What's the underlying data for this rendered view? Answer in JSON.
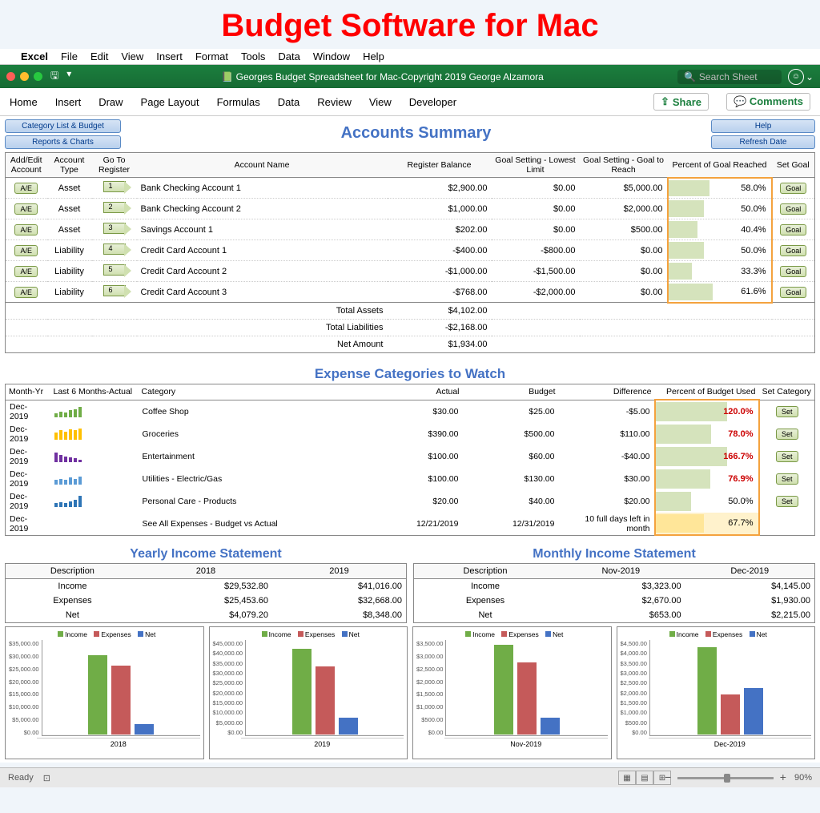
{
  "page_heading": "Budget Software for Mac",
  "menubar": [
    "Excel",
    "File",
    "Edit",
    "View",
    "Insert",
    "Format",
    "Tools",
    "Data",
    "Window",
    "Help"
  ],
  "doc_title": "Georges Budget Spreadsheet for Mac-Copyright 2019 George Alzamora",
  "search_placeholder": "Search Sheet",
  "ribbon": [
    "Home",
    "Insert",
    "Draw",
    "Page Layout",
    "Formulas",
    "Data",
    "Review",
    "View",
    "Developer"
  ],
  "share_label": "Share",
  "comments_label": "Comments",
  "buttons": {
    "cat_list": "Category List & Budget",
    "reports": "Reports & Charts",
    "help": "Help",
    "refresh": "Refresh Date"
  },
  "accounts_summary": {
    "title": "Accounts Summary",
    "headers": {
      "ae": "Add/Edit Account",
      "type": "Account Type",
      "goto": "Go To Register",
      "name": "Account Name",
      "balance": "Register Balance",
      "lowest": "Goal Setting - Lowest Limit",
      "goal": "Goal Setting - Goal to Reach",
      "percent": "Percent of Goal Reached",
      "set": "Set Goal"
    },
    "ae_label": "A/E",
    "goal_label": "Goal",
    "rows": [
      {
        "n": "1",
        "type": "Asset",
        "name": "Bank Checking Account 1",
        "balance": "$2,900.00",
        "lowest": "$0.00",
        "goal": "$5,000.00",
        "pct": 58.0,
        "pct_txt": "58.0%"
      },
      {
        "n": "2",
        "type": "Asset",
        "name": "Bank Checking Account 2",
        "balance": "$1,000.00",
        "lowest": "$0.00",
        "goal": "$2,000.00",
        "pct": 50.0,
        "pct_txt": "50.0%"
      },
      {
        "n": "3",
        "type": "Asset",
        "name": "Savings Account 1",
        "balance": "$202.00",
        "lowest": "$0.00",
        "goal": "$500.00",
        "pct": 40.4,
        "pct_txt": "40.4%"
      },
      {
        "n": "4",
        "type": "Liability",
        "name": "Credit Card Account 1",
        "balance": "-$400.00",
        "lowest": "-$800.00",
        "goal": "$0.00",
        "pct": 50.0,
        "pct_txt": "50.0%"
      },
      {
        "n": "5",
        "type": "Liability",
        "name": "Credit Card Account 2",
        "balance": "-$1,000.00",
        "lowest": "-$1,500.00",
        "goal": "$0.00",
        "pct": 33.3,
        "pct_txt": "33.3%"
      },
      {
        "n": "6",
        "type": "Liability",
        "name": "Credit Card Account 3",
        "balance": "-$768.00",
        "lowest": "-$2,000.00",
        "goal": "$0.00",
        "pct": 61.6,
        "pct_txt": "61.6%"
      }
    ],
    "totals": {
      "assets_l": "Total Assets",
      "assets_v": "$4,102.00",
      "liab_l": "Total Liabilities",
      "liab_v": "-$2,168.00",
      "net_l": "Net Amount",
      "net_v": "$1,934.00"
    }
  },
  "expense_watch": {
    "title": "Expense Categories to Watch",
    "headers": {
      "month": "Month-Yr",
      "last6": "Last 6 Months-Actual",
      "cat": "Category",
      "actual": "Actual",
      "budget": "Budget",
      "diff": "Difference",
      "pct": "Percent of Budget Used",
      "set": "Set Category"
    },
    "set_label": "Set",
    "rows": [
      {
        "month": "Dec-2019",
        "spark": [
          3,
          5,
          4,
          6,
          7,
          9
        ],
        "color": "#70ad47",
        "cat": "Coffee Shop",
        "actual": "$30.00",
        "budget": "$25.00",
        "diff": "-$5.00",
        "pct": 120.0,
        "pct_txt": "120.0%",
        "over": true
      },
      {
        "month": "Dec-2019",
        "spark": [
          6,
          8,
          7,
          9,
          8,
          10
        ],
        "color": "#ffc000",
        "cat": "Groceries",
        "actual": "$390.00",
        "budget": "$500.00",
        "diff": "$110.00",
        "pct": 78.0,
        "pct_txt": "78.0%",
        "over": true
      },
      {
        "month": "Dec-2019",
        "spark": [
          8,
          6,
          5,
          4,
          3,
          2
        ],
        "color": "#7030a0",
        "cat": "Entertainment",
        "actual": "$100.00",
        "budget": "$60.00",
        "diff": "-$40.00",
        "pct": 166.7,
        "pct_txt": "166.7%",
        "over": true
      },
      {
        "month": "Dec-2019",
        "spark": [
          4,
          5,
          4,
          6,
          5,
          7
        ],
        "color": "#5b9bd5",
        "cat": "Utilities - Electric/Gas",
        "actual": "$100.00",
        "budget": "$130.00",
        "diff": "$30.00",
        "pct": 76.9,
        "pct_txt": "76.9%",
        "over": true
      },
      {
        "month": "Dec-2019",
        "spark": [
          3,
          4,
          3,
          5,
          6,
          10
        ],
        "color": "#2e75b6",
        "cat": "Personal Care - Products",
        "actual": "$20.00",
        "budget": "$40.00",
        "diff": "$20.00",
        "pct": 50.0,
        "pct_txt": "50.0%",
        "over": false
      }
    ],
    "summary": {
      "month": "Dec-2019",
      "cat": "See All Expenses - Budget vs Actual",
      "actual": "12/21/2019",
      "budget": "12/31/2019",
      "diff": "10 full days left in month",
      "pct": 67.7,
      "pct_txt": "67.7%"
    }
  },
  "yearly": {
    "title": "Yearly Income Statement",
    "headers": {
      "desc": "Description",
      "c1": "2018",
      "c2": "2019"
    },
    "rows": [
      {
        "desc": "Income",
        "c1": "$29,532.80",
        "c2": "$41,016.00"
      },
      {
        "desc": "Expenses",
        "c1": "$25,453.60",
        "c2": "$32,668.00"
      },
      {
        "desc": "Net",
        "c1": "$4,079.20",
        "c2": "$8,348.00"
      }
    ]
  },
  "monthly": {
    "title": "Monthly Income Statement",
    "headers": {
      "desc": "Description",
      "c1": "Nov-2019",
      "c2": "Dec-2019"
    },
    "rows": [
      {
        "desc": "Income",
        "c1": "$3,323.00",
        "c2": "$4,145.00"
      },
      {
        "desc": "Expenses",
        "c1": "$2,670.00",
        "c2": "$1,930.00"
      },
      {
        "desc": "Net",
        "c1": "$653.00",
        "c2": "$2,215.00"
      }
    ]
  },
  "chart_legend": {
    "income": "Income",
    "expenses": "Expenses",
    "net": "Net"
  },
  "chart_data": [
    {
      "type": "bar",
      "title": "2018",
      "categories": [
        "Income",
        "Expenses",
        "Net"
      ],
      "values": [
        29532.8,
        25453.6,
        4079.2
      ],
      "ylim": [
        0,
        35000
      ],
      "yticks": [
        "$35,000.00",
        "$30,000.00",
        "$25,000.00",
        "$20,000.00",
        "$15,000.00",
        "$10,000.00",
        "$5,000.00",
        "$0.00"
      ]
    },
    {
      "type": "bar",
      "title": "2019",
      "categories": [
        "Income",
        "Expenses",
        "Net"
      ],
      "values": [
        41016.0,
        32668.0,
        8348.0
      ],
      "ylim": [
        0,
        45000
      ],
      "yticks": [
        "$45,000.00",
        "$40,000.00",
        "$35,000.00",
        "$30,000.00",
        "$25,000.00",
        "$20,000.00",
        "$15,000.00",
        "$10,000.00",
        "$5,000.00",
        "$0.00"
      ]
    },
    {
      "type": "bar",
      "title": "Nov-2019",
      "categories": [
        "Income",
        "Expenses",
        "Net"
      ],
      "values": [
        3323.0,
        2670.0,
        653.0
      ],
      "ylim": [
        0,
        3500
      ],
      "yticks": [
        "$3,500.00",
        "$3,000.00",
        "$2,500.00",
        "$2,000.00",
        "$1,500.00",
        "$1,000.00",
        "$500.00",
        "$0.00"
      ]
    },
    {
      "type": "bar",
      "title": "Dec-2019",
      "categories": [
        "Income",
        "Expenses",
        "Net"
      ],
      "values": [
        4145.0,
        1930.0,
        2215.0
      ],
      "ylim": [
        0,
        4500
      ],
      "yticks": [
        "$4,500.00",
        "$4,000.00",
        "$3,500.00",
        "$3,000.00",
        "$2,500.00",
        "$2,000.00",
        "$1,500.00",
        "$1,000.00",
        "$500.00",
        "$0.00"
      ]
    }
  ],
  "status": {
    "ready": "Ready",
    "zoom": "90%"
  },
  "colors": {
    "income": "#70ad47",
    "expenses": "#c55a5a",
    "net": "#4472c4"
  }
}
